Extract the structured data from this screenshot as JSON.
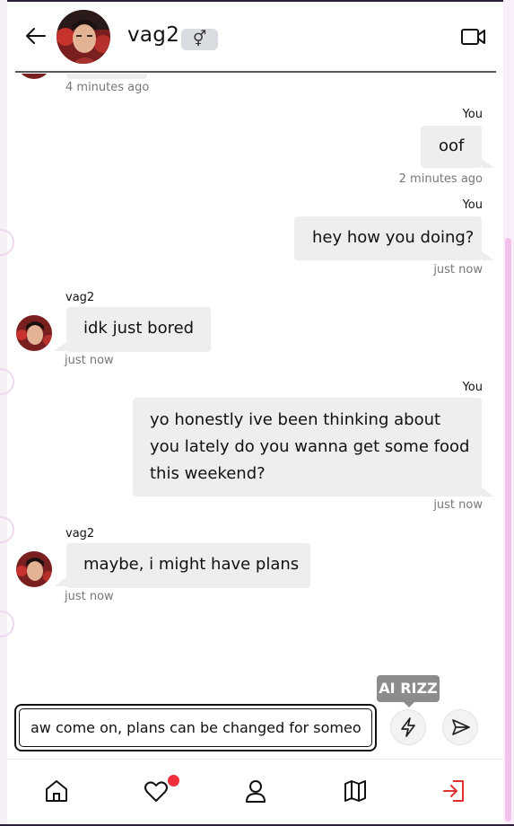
{
  "header": {
    "username": "vag2",
    "gender_symbol": "⚥"
  },
  "messages": [
    {
      "from": "them",
      "sender": "",
      "text": "",
      "time": "4 minutes ago"
    },
    {
      "from": "me",
      "sender": "You",
      "text": "oof",
      "time": "2 minutes ago"
    },
    {
      "from": "me",
      "sender": "You",
      "text": "hey how you doing?",
      "time": "just now"
    },
    {
      "from": "them",
      "sender": "vag2",
      "text": "idk just bored",
      "time": "just now"
    },
    {
      "from": "me",
      "sender": "You",
      "text": "yo honestly ive been thinking about\nyou lately do you wanna get some food\nthis weekend?",
      "time": "just now"
    },
    {
      "from": "them",
      "sender": "vag2",
      "text": "maybe, i might have plans",
      "time": "just now"
    }
  ],
  "composer": {
    "value": "aw come on, plans can be changed for someone",
    "ai_tooltip": "AI RIZZ"
  },
  "icons": {
    "back": "arrow-left-icon",
    "video": "video-camera-icon",
    "ai": "lightning-icon",
    "send": "send-icon",
    "nav": [
      "home-icon",
      "heart-icon",
      "user-icon",
      "map-icon",
      "logout-icon"
    ]
  },
  "colors": {
    "bubble": "#eeeeee",
    "notification": "#ee2d3d",
    "logout": "#e03131",
    "tooltip": "#8c8c8c"
  }
}
